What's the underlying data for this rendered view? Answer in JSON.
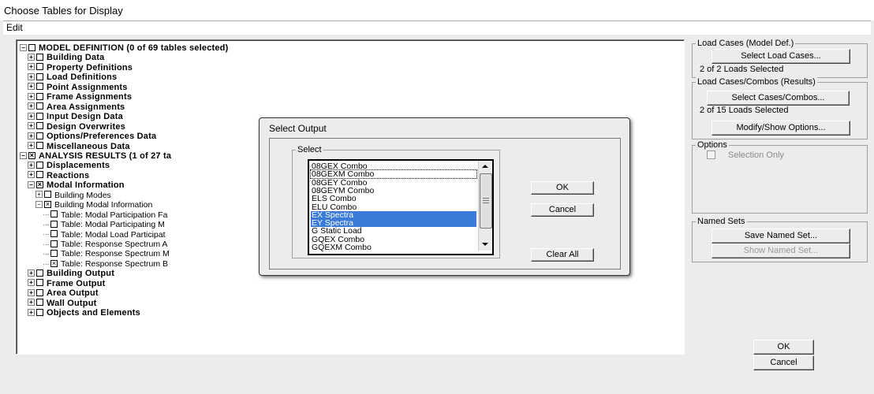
{
  "window": {
    "title": "Choose Tables for Display"
  },
  "menu": {
    "edit": "Edit"
  },
  "tree": [
    {
      "label": "MODEL DEFINITION  (0 of 69 tables selected)",
      "level": 0,
      "expander": "minus",
      "check": "",
      "bold": true
    },
    {
      "label": "Building Data",
      "level": 1,
      "expander": "plus",
      "check": "",
      "bold": true
    },
    {
      "label": "Property Definitions",
      "level": 1,
      "expander": "plus",
      "check": "",
      "bold": true
    },
    {
      "label": "Load Definitions",
      "level": 1,
      "expander": "plus",
      "check": "",
      "bold": true
    },
    {
      "label": "Point Assignments",
      "level": 1,
      "expander": "plus",
      "check": "",
      "bold": true
    },
    {
      "label": "Frame Assignments",
      "level": 1,
      "expander": "plus",
      "check": "",
      "bold": true
    },
    {
      "label": "Area Assignments",
      "level": 1,
      "expander": "plus",
      "check": "",
      "bold": true
    },
    {
      "label": "Input Design Data",
      "level": 1,
      "expander": "plus",
      "check": "",
      "bold": true
    },
    {
      "label": "Design Overwrites",
      "level": 1,
      "expander": "plus",
      "check": "",
      "bold": true
    },
    {
      "label": "Options/Preferences Data",
      "level": 1,
      "expander": "plus",
      "check": "",
      "bold": true
    },
    {
      "label": "Miscellaneous Data",
      "level": 1,
      "expander": "plus",
      "check": "",
      "bold": true
    },
    {
      "label": "ANALYSIS RESULTS  (1 of 27 ta",
      "level": 0,
      "expander": "minus",
      "check": "x",
      "bold": true
    },
    {
      "label": "Displacements",
      "level": 1,
      "expander": "plus",
      "check": "",
      "bold": true
    },
    {
      "label": "Reactions",
      "level": 1,
      "expander": "plus",
      "check": "",
      "bold": true
    },
    {
      "label": "Modal Information",
      "level": 1,
      "expander": "minus",
      "check": "x",
      "bold": true
    },
    {
      "label": "Building Modes",
      "level": 2,
      "expander": "plus",
      "check": "",
      "bold": false
    },
    {
      "label": "Building Modal Information",
      "level": 2,
      "expander": "minus",
      "check": "x",
      "bold": false
    },
    {
      "label": "Table:  Modal Participation Fa",
      "level": 3,
      "expander": "",
      "check": "",
      "bold": false
    },
    {
      "label": "Table:  Modal Participating M",
      "level": 3,
      "expander": "",
      "check": "",
      "bold": false
    },
    {
      "label": "Table:  Modal Load Participat",
      "level": 3,
      "expander": "",
      "check": "",
      "bold": false
    },
    {
      "label": "Table:  Response Spectrum A",
      "level": 3,
      "expander": "",
      "check": "",
      "bold": false
    },
    {
      "label": "Table:  Response Spectrum M",
      "level": 3,
      "expander": "",
      "check": "",
      "bold": false
    },
    {
      "label": "Table:  Response Spectrum B",
      "level": 3,
      "expander": "",
      "check": "x",
      "bold": false
    },
    {
      "label": "Building Output",
      "level": 1,
      "expander": "plus",
      "check": "",
      "bold": true
    },
    {
      "label": "Frame Output",
      "level": 1,
      "expander": "plus",
      "check": "",
      "bold": true
    },
    {
      "label": "Area Output",
      "level": 1,
      "expander": "plus",
      "check": "",
      "bold": true
    },
    {
      "label": "Wall Output",
      "level": 1,
      "expander": "plus",
      "check": "",
      "bold": true
    },
    {
      "label": "Objects and Elements",
      "level": 1,
      "expander": "plus",
      "check": "",
      "bold": true
    }
  ],
  "right": {
    "load_cases_model": {
      "group": "Load Cases (Model Def.)",
      "button": "Select Load Cases...",
      "status": "2  of  2  Loads Selected"
    },
    "load_cases_results": {
      "group": "Load Cases/Combos (Results)",
      "button": "Select Cases/Combos...",
      "status": "2  of  15  Loads Selected",
      "modify_button": "Modify/Show Options..."
    },
    "options": {
      "group": "Options",
      "selection_only": "Selection Only"
    },
    "named_sets": {
      "group": "Named Sets",
      "save_button": "Save Named Set...",
      "show_button": "Show Named Set..."
    },
    "ok": "OK",
    "cancel": "Cancel"
  },
  "dialog": {
    "title": "Select Output",
    "group": "Select",
    "items": [
      {
        "label": "08GEX Combo",
        "selected": false,
        "focused": false
      },
      {
        "label": "08GEXM Combo",
        "selected": false,
        "focused": true
      },
      {
        "label": "08GEY Combo",
        "selected": false,
        "focused": false
      },
      {
        "label": "08GEYM Combo",
        "selected": false,
        "focused": false
      },
      {
        "label": "ELS Combo",
        "selected": false,
        "focused": false
      },
      {
        "label": "ELU Combo",
        "selected": false,
        "focused": false
      },
      {
        "label": "EX Spectra",
        "selected": true,
        "focused": false
      },
      {
        "label": "EY Spectra",
        "selected": true,
        "focused": false
      },
      {
        "label": "G Static Load",
        "selected": false,
        "focused": false
      },
      {
        "label": "GQEX Combo",
        "selected": false,
        "focused": false
      },
      {
        "label": "GQEXM Combo",
        "selected": false,
        "focused": false
      }
    ],
    "ok": "OK",
    "cancel": "Cancel",
    "clear_all": "Clear All"
  },
  "colors": {
    "selection": "#3a7ad9",
    "window_bg": "#ececec"
  }
}
